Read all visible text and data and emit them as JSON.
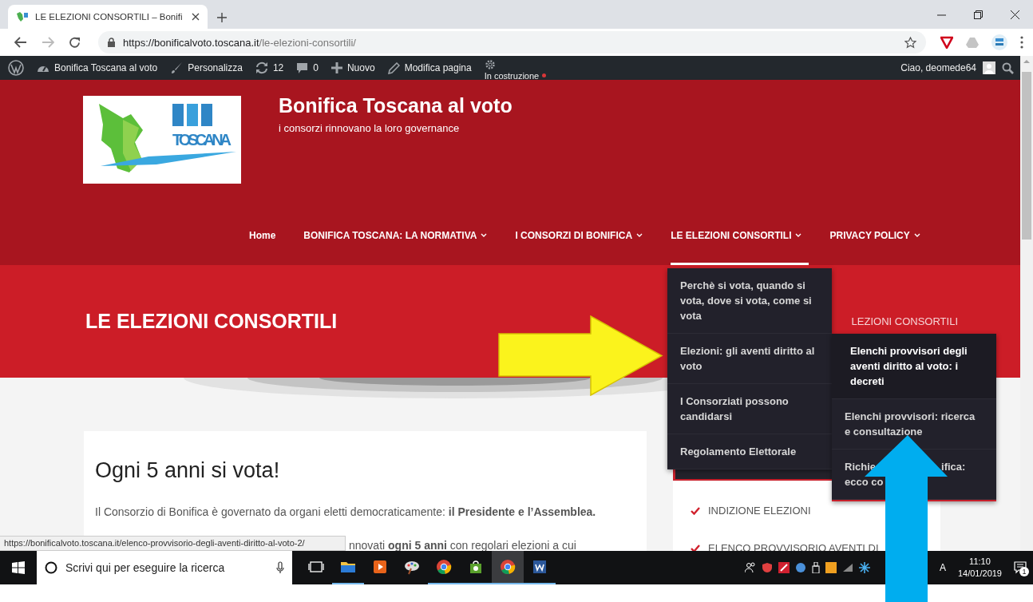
{
  "browser": {
    "tab": {
      "title": "LE ELEZIONI CONSORTILI – Bonifi",
      "selected": true
    },
    "url_host": "https://bonificalvoto.toscana.it",
    "url_path": "/le-elezioni-consortili/"
  },
  "admin_bar": {
    "items": [
      {
        "kind": "site",
        "label": "Bonifica Toscana al voto"
      },
      {
        "kind": "customize",
        "label": "Personalizza"
      },
      {
        "kind": "updates",
        "label": "12"
      },
      {
        "kind": "comments",
        "label": "0"
      },
      {
        "kind": "new",
        "label": "Nuovo"
      },
      {
        "kind": "edit",
        "label": "Modifica pagina"
      }
    ],
    "status": "In costruzione",
    "greeting": "Ciao, deomede64"
  },
  "site": {
    "logo_text": "TOSCANA",
    "title": "Bonifica Toscana al voto",
    "tagline": "i consorzi rinnovano la loro governance"
  },
  "nav": [
    {
      "label": "Home",
      "dropdown": false,
      "selected": false
    },
    {
      "label": "BONIFICA TOSCANA: LA NORMATIVA",
      "dropdown": true,
      "selected": false
    },
    {
      "label": "I CONSORZI DI BONIFICA",
      "dropdown": true,
      "selected": false
    },
    {
      "label": "LE ELEZIONI CONSORTILI",
      "dropdown": true,
      "selected": true
    },
    {
      "label": "PRIVACY POLICY",
      "dropdown": true,
      "selected": false
    }
  ],
  "page_title": "LE ELEZIONI CONSORTILI",
  "breadcrumb": "LEZIONI CONSORTILI",
  "article": {
    "heading": "Ogni 5 anni si vota!",
    "paragraph": "Il Consorzio di Bonifica è governato da organi eletti democraticamente: **il Presidente e l’Assemblea.**",
    "partial_line": "nnovati **ogni 5 anni** con regolari elezioni a cui"
  },
  "sidebar": {
    "items": [
      "INDIZIONE ELEZIONI",
      "ELENCO PROVVISORIO AVENTI DI"
    ]
  },
  "menu": {
    "items": [
      "Perchè si vota, quando si vota, dove si vota, come si vota",
      "Elezioni: gli aventi diritto al voto",
      "I Consorziati possono candidarsi",
      "Regolamento Elettorale"
    ]
  },
  "submenu": {
    "items": [
      {
        "label": "Elenchi provvisori degli aventi diritto al voto: i decreti",
        "selected": true
      },
      {
        "label": "Elenchi provvisori: ricerca e consultazione",
        "selected": false
      },
      {
        "fragments": [
          [
            "Richie",
            "ifica:"
          ],
          [
            "ecco co"
          ]
        ],
        "selected": false
      }
    ]
  },
  "status_url": "https://bonificalvoto.toscana.it/elenco-provvisorio-degli-aventi-diritto-al-voto-2/",
  "taskbar": {
    "search_placeholder": "Scrivi qui per eseguire la ricerca",
    "apps": [
      {
        "kind": "taskview",
        "running": false,
        "selected": false
      },
      {
        "kind": "explorer",
        "running": true,
        "selected": false
      },
      {
        "kind": "media",
        "running": false,
        "selected": false
      },
      {
        "kind": "paint",
        "running": false,
        "selected": false
      },
      {
        "kind": "chrome",
        "running": true,
        "selected": false
      },
      {
        "kind": "hp",
        "running": true,
        "selected": false
      },
      {
        "kind": "chrome",
        "running": true,
        "selected": true
      },
      {
        "kind": "word",
        "running": true,
        "selected": false
      }
    ]
  },
  "tray": {
    "language": "A",
    "time": "11:10",
    "date": "14/01/2019",
    "notifications": "1"
  }
}
